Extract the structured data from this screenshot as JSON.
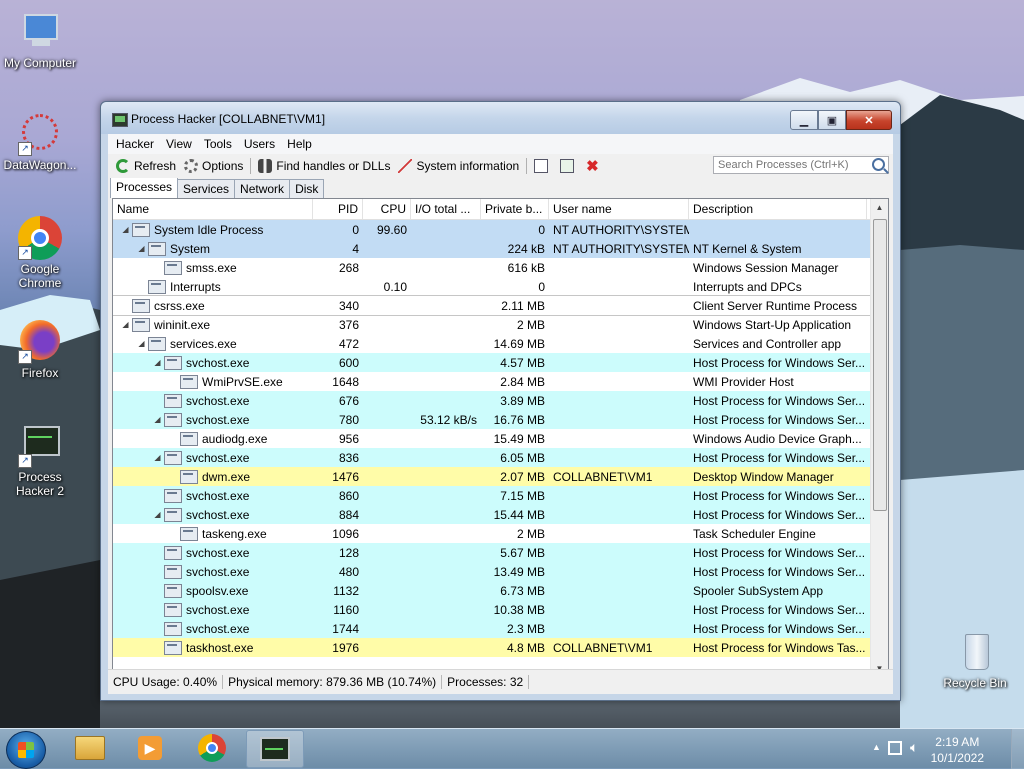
{
  "desktop": {
    "icons": [
      {
        "label": "My Computer",
        "icon": "computer-icon"
      },
      {
        "label": "DataWagon...",
        "icon": "datawagon-icon"
      },
      {
        "label": "Google Chrome",
        "icon": "chrome-icon"
      },
      {
        "label": "Firefox",
        "icon": "firefox-icon"
      },
      {
        "label": "Process Hacker 2",
        "icon": "process-hacker-icon"
      },
      {
        "label": "Recycle Bin",
        "icon": "recycle-bin-icon"
      }
    ]
  },
  "window": {
    "title": "Process Hacker [COLLABNET\\VM1]",
    "menu": [
      "Hacker",
      "View",
      "Tools",
      "Users",
      "Help"
    ],
    "toolbar": {
      "refresh": "Refresh",
      "options": "Options",
      "find": "Find handles or DLLs",
      "sysinfo": "System information",
      "search_placeholder": "Search Processes (Ctrl+K)"
    },
    "tabs": [
      "Processes",
      "Services",
      "Network",
      "Disk"
    ],
    "columns": [
      "Name",
      "PID",
      "CPU",
      "I/O total ...",
      "Private b...",
      "User name",
      "Description"
    ],
    "rows": [
      {
        "indent": 0,
        "exp": "◢",
        "name": "System Idle Process",
        "pid": "0",
        "cpu": "99.60",
        "io": "",
        "priv": "0",
        "user": "NT AUTHORITY\\SYSTEM",
        "desc": "",
        "bg": "blue"
      },
      {
        "indent": 1,
        "exp": "◢",
        "name": "System",
        "pid": "4",
        "cpu": "",
        "io": "",
        "priv": "224 kB",
        "user": "NT AUTHORITY\\SYSTEM",
        "desc": "NT Kernel & System",
        "bg": "blue"
      },
      {
        "indent": 2,
        "exp": "",
        "name": "smss.exe",
        "pid": "268",
        "cpu": "",
        "io": "",
        "priv": "616 kB",
        "user": "",
        "desc": "Windows Session Manager",
        "bg": "white"
      },
      {
        "indent": 1,
        "exp": "",
        "name": "Interrupts",
        "pid": "",
        "cpu": "0.10",
        "io": "",
        "priv": "0",
        "user": "",
        "desc": "Interrupts and DPCs",
        "bg": "white"
      },
      {
        "indent": 0,
        "exp": "",
        "name": "csrss.exe",
        "pid": "340",
        "cpu": "",
        "io": "",
        "priv": "2.11 MB",
        "user": "",
        "desc": "Client Server Runtime Process",
        "bg": "sel"
      },
      {
        "indent": 0,
        "exp": "◢",
        "name": "wininit.exe",
        "pid": "376",
        "cpu": "",
        "io": "",
        "priv": "2 MB",
        "user": "",
        "desc": "Windows Start-Up Application",
        "bg": "white"
      },
      {
        "indent": 1,
        "exp": "◢",
        "name": "services.exe",
        "pid": "472",
        "cpu": "",
        "io": "",
        "priv": "14.69 MB",
        "user": "",
        "desc": "Services and Controller app",
        "bg": "white"
      },
      {
        "indent": 2,
        "exp": "◢",
        "name": "svchost.exe",
        "pid": "600",
        "cpu": "",
        "io": "",
        "priv": "4.57 MB",
        "user": "",
        "desc": "Host Process for Windows Ser...",
        "bg": "cyan"
      },
      {
        "indent": 3,
        "exp": "",
        "name": "WmiPrvSE.exe",
        "pid": "1648",
        "cpu": "",
        "io": "",
        "priv": "2.84 MB",
        "user": "",
        "desc": "WMI Provider Host",
        "bg": "white"
      },
      {
        "indent": 2,
        "exp": "",
        "name": "svchost.exe",
        "pid": "676",
        "cpu": "",
        "io": "",
        "priv": "3.89 MB",
        "user": "",
        "desc": "Host Process for Windows Ser...",
        "bg": "cyan"
      },
      {
        "indent": 2,
        "exp": "◢",
        "name": "svchost.exe",
        "pid": "780",
        "cpu": "",
        "io": "53.12 kB/s",
        "priv": "16.76 MB",
        "user": "",
        "desc": "Host Process for Windows Ser...",
        "bg": "cyan"
      },
      {
        "indent": 3,
        "exp": "",
        "name": "audiodg.exe",
        "pid": "956",
        "cpu": "",
        "io": "",
        "priv": "15.49 MB",
        "user": "",
        "desc": "Windows Audio Device Graph...",
        "bg": "white"
      },
      {
        "indent": 2,
        "exp": "◢",
        "name": "svchost.exe",
        "pid": "836",
        "cpu": "",
        "io": "",
        "priv": "6.05 MB",
        "user": "",
        "desc": "Host Process for Windows Ser...",
        "bg": "cyan"
      },
      {
        "indent": 3,
        "exp": "",
        "name": "dwm.exe",
        "pid": "1476",
        "cpu": "",
        "io": "",
        "priv": "2.07 MB",
        "user": "COLLABNET\\VM1",
        "desc": "Desktop Window Manager",
        "bg": "yellow"
      },
      {
        "indent": 2,
        "exp": "",
        "name": "svchost.exe",
        "pid": "860",
        "cpu": "",
        "io": "",
        "priv": "7.15 MB",
        "user": "",
        "desc": "Host Process for Windows Ser...",
        "bg": "cyan"
      },
      {
        "indent": 2,
        "exp": "◢",
        "name": "svchost.exe",
        "pid": "884",
        "cpu": "",
        "io": "",
        "priv": "15.44 MB",
        "user": "",
        "desc": "Host Process for Windows Ser...",
        "bg": "cyan"
      },
      {
        "indent": 3,
        "exp": "",
        "name": "taskeng.exe",
        "pid": "1096",
        "cpu": "",
        "io": "",
        "priv": "2 MB",
        "user": "",
        "desc": "Task Scheduler Engine",
        "bg": "white"
      },
      {
        "indent": 2,
        "exp": "",
        "name": "svchost.exe",
        "pid": "128",
        "cpu": "",
        "io": "",
        "priv": "5.67 MB",
        "user": "",
        "desc": "Host Process for Windows Ser...",
        "bg": "cyan"
      },
      {
        "indent": 2,
        "exp": "",
        "name": "svchost.exe",
        "pid": "480",
        "cpu": "",
        "io": "",
        "priv": "13.49 MB",
        "user": "",
        "desc": "Host Process for Windows Ser...",
        "bg": "cyan"
      },
      {
        "indent": 2,
        "exp": "",
        "name": "spoolsv.exe",
        "pid": "1132",
        "cpu": "",
        "io": "",
        "priv": "6.73 MB",
        "user": "",
        "desc": "Spooler SubSystem App",
        "bg": "cyan"
      },
      {
        "indent": 2,
        "exp": "",
        "name": "svchost.exe",
        "pid": "1160",
        "cpu": "",
        "io": "",
        "priv": "10.38 MB",
        "user": "",
        "desc": "Host Process for Windows Ser...",
        "bg": "cyan"
      },
      {
        "indent": 2,
        "exp": "",
        "name": "svchost.exe",
        "pid": "1744",
        "cpu": "",
        "io": "",
        "priv": "2.3 MB",
        "user": "",
        "desc": "Host Process for Windows Ser...",
        "bg": "cyan"
      },
      {
        "indent": 2,
        "exp": "",
        "name": "taskhost.exe",
        "pid": "1976",
        "cpu": "",
        "io": "",
        "priv": "4.8 MB",
        "user": "COLLABNET\\VM1",
        "desc": "Host Process for Windows Tas...",
        "bg": "yellow"
      }
    ],
    "status": {
      "cpu": "CPU Usage: 0.40%",
      "memory": "Physical memory: 879.36 MB (10.74%)",
      "processes": "Processes: 32"
    }
  },
  "taskbar": {
    "time": "2:19 AM",
    "date": "10/1/2022",
    "items": [
      "explorer-icon",
      "media-player-icon",
      "chrome-icon",
      "process-hacker-icon"
    ]
  }
}
